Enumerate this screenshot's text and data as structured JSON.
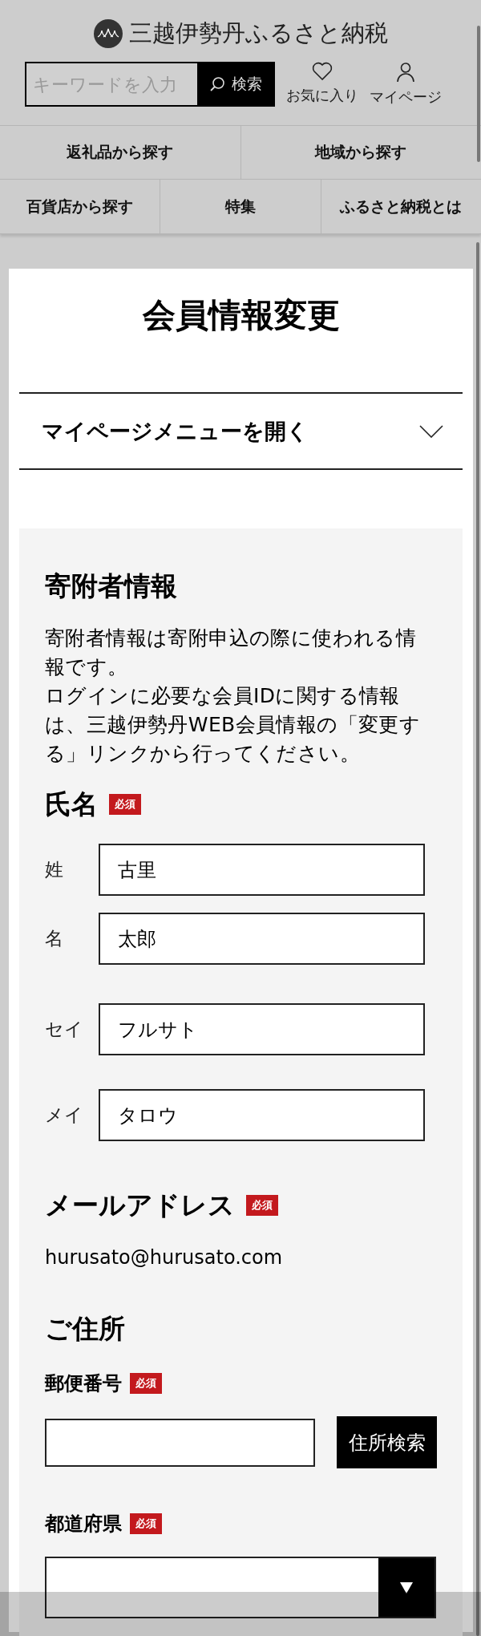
{
  "header": {
    "logo_text": "三越伊勢丹ふるさと納税",
    "search": {
      "placeholder": "キーワードを入力",
      "button": "検索"
    },
    "actions": [
      {
        "kind": "heart",
        "label": "お気に入り"
      },
      {
        "kind": "person",
        "label": "マイページ"
      }
    ]
  },
  "nav_rows": [
    [
      {
        "label": "返礼品から探す"
      },
      {
        "label": "地域から探す"
      }
    ],
    [
      {
        "label": "百貨店から探す"
      },
      {
        "label": "特集"
      },
      {
        "label": "ふるさと納税とは"
      }
    ]
  ],
  "page_title": "会員情報変更",
  "mypage_menu": {
    "label": "マイページメニューを開く",
    "expanded": false
  },
  "donor_section": {
    "title": "寄附者情報",
    "paragraphs": [
      "寄附者情報は寄附申込の際に使われる情報です。",
      "ログインに必要な会員IDに関する情報は、三越伊勢丹WEB会員情報の「変更する」リンクから行ってください。"
    ]
  },
  "name_group": {
    "title": "氏名",
    "badge": "必須",
    "fields": [
      {
        "label": "姓",
        "value": "古里"
      },
      {
        "label": "名",
        "value": "太郎"
      },
      {
        "label": "セイ",
        "value": "フルサト"
      },
      {
        "label": "メイ",
        "value": "タロウ"
      }
    ]
  },
  "email": {
    "title": "メールアドレス",
    "badge": "必須",
    "value": "hurusato@hurusato.com"
  },
  "address": {
    "title": "ご住所",
    "postal": {
      "label": "郵便番号",
      "badge": "必須",
      "button": "住所検索"
    },
    "prefecture": {
      "label": "都道府県",
      "badge": "必須"
    }
  }
}
